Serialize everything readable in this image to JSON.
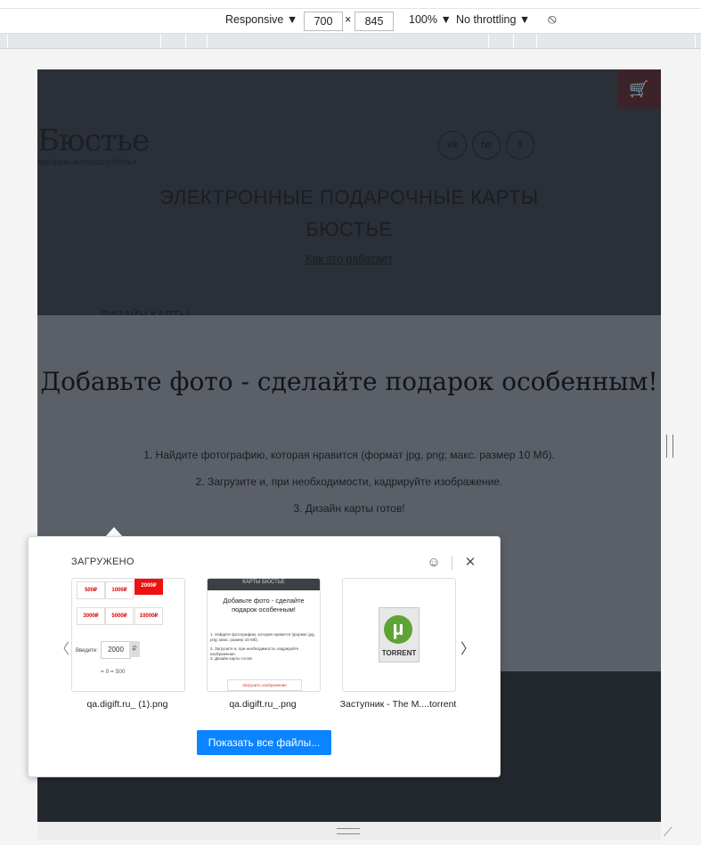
{
  "devtools": {
    "device": "Responsive",
    "width": "700",
    "times": "×",
    "height": "845",
    "zoom": "100%",
    "throttling": "No throttling"
  },
  "site": {
    "logo": "Бюстье",
    "logo_sub": "магазин женского белья",
    "social": [
      "vk",
      "tw",
      "f"
    ],
    "hero_title_line1": "ЭЛЕКТРОННЫЕ ПОДАРОЧНЫЕ КАРТЫ",
    "hero_title_line2": "БЮСТЬЕ",
    "hero_link": "Как это работает",
    "hero_cut": "ДИЗАЙН КАРТЫ"
  },
  "modal": {
    "title": "Добавьте фото - сделайте подарок особенным!",
    "steps": [
      "1. Найдите фотографию, которая нравится (формат jpg, png; макс. размер 10 Мб).",
      "2. Загрузите и, при необходимости, кадрируйте изображение.",
      "3. Дизайн карты готов!"
    ]
  },
  "downloads": {
    "header": "ЗАГРУЖЕНО",
    "files": [
      {
        "name": "qa.digift.ru_ (1).png"
      },
      {
        "name": "qa.digift.ru_.png"
      },
      {
        "name": "Заступник - The M....torrent"
      }
    ],
    "show_all": "Показать все файлы...",
    "thumb1": {
      "cells": [
        "500₽",
        "1000₽",
        "2000₽",
        "3000₽",
        "5000₽",
        "10000₽"
      ],
      "enter_label": "Введите:",
      "enter_value": "2000",
      "currency": "₽",
      "summary": "= 0 = 500"
    },
    "thumb2": {
      "head": "КАРТЫ БЮСТЬЕ",
      "title": "Добавьте фото - сделайте подарок особенным!",
      "lines": [
        "1. Найдите фотографию, которая нравится (формат jpg, png; макс. размер 10 Мб).",
        "2. Загрузите и, при необходимости, кадрируйте изображение.",
        "3. Дизайн карты готов!"
      ],
      "button": "Загрузить изображение"
    },
    "thumb3": {
      "logo_letter": "µ",
      "caption": "TORRENT"
    }
  }
}
